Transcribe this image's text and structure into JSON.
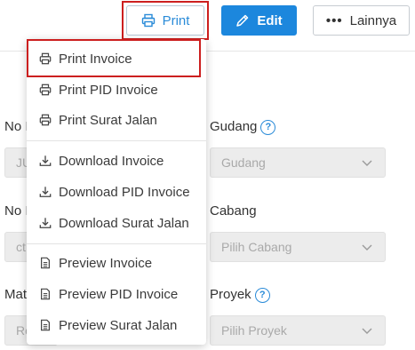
{
  "toolbar": {
    "print_label": "Print",
    "edit_label": "Edit",
    "more_label": "Lainnya",
    "more_glyph": "•••"
  },
  "form": {
    "no1_label": "No I",
    "no1_value": "JU",
    "gudang_label": "Gudang",
    "gudang_placeholder": "Gudang",
    "no2_label": "No I",
    "no2_value": "ct",
    "cabang_label": "Cabang",
    "cabang_placeholder": "Pilih Cabang",
    "mat_label": "Mat",
    "mat_value": "Re",
    "proyek_label": "Proyek",
    "proyek_placeholder": "Pilih Proyek",
    "help_glyph": "?"
  },
  "menu": {
    "items": [
      {
        "label": "Print Invoice",
        "icon": "printer-icon"
      },
      {
        "label": "Print PID Invoice",
        "icon": "printer-icon"
      },
      {
        "label": "Print Surat Jalan",
        "icon": "printer-icon"
      },
      {
        "label": "Download Invoice",
        "icon": "download-icon"
      },
      {
        "label": "Download PID Invoice",
        "icon": "download-icon"
      },
      {
        "label": "Download Surat Jalan",
        "icon": "download-icon"
      },
      {
        "label": "Preview Invoice",
        "icon": "document-icon"
      },
      {
        "label": "Preview PID Invoice",
        "icon": "document-icon"
      },
      {
        "label": "Preview Surat Jalan",
        "icon": "document-icon"
      }
    ]
  },
  "colors": {
    "accent": "#1c87dd",
    "highlight": "#cc1f1f"
  }
}
